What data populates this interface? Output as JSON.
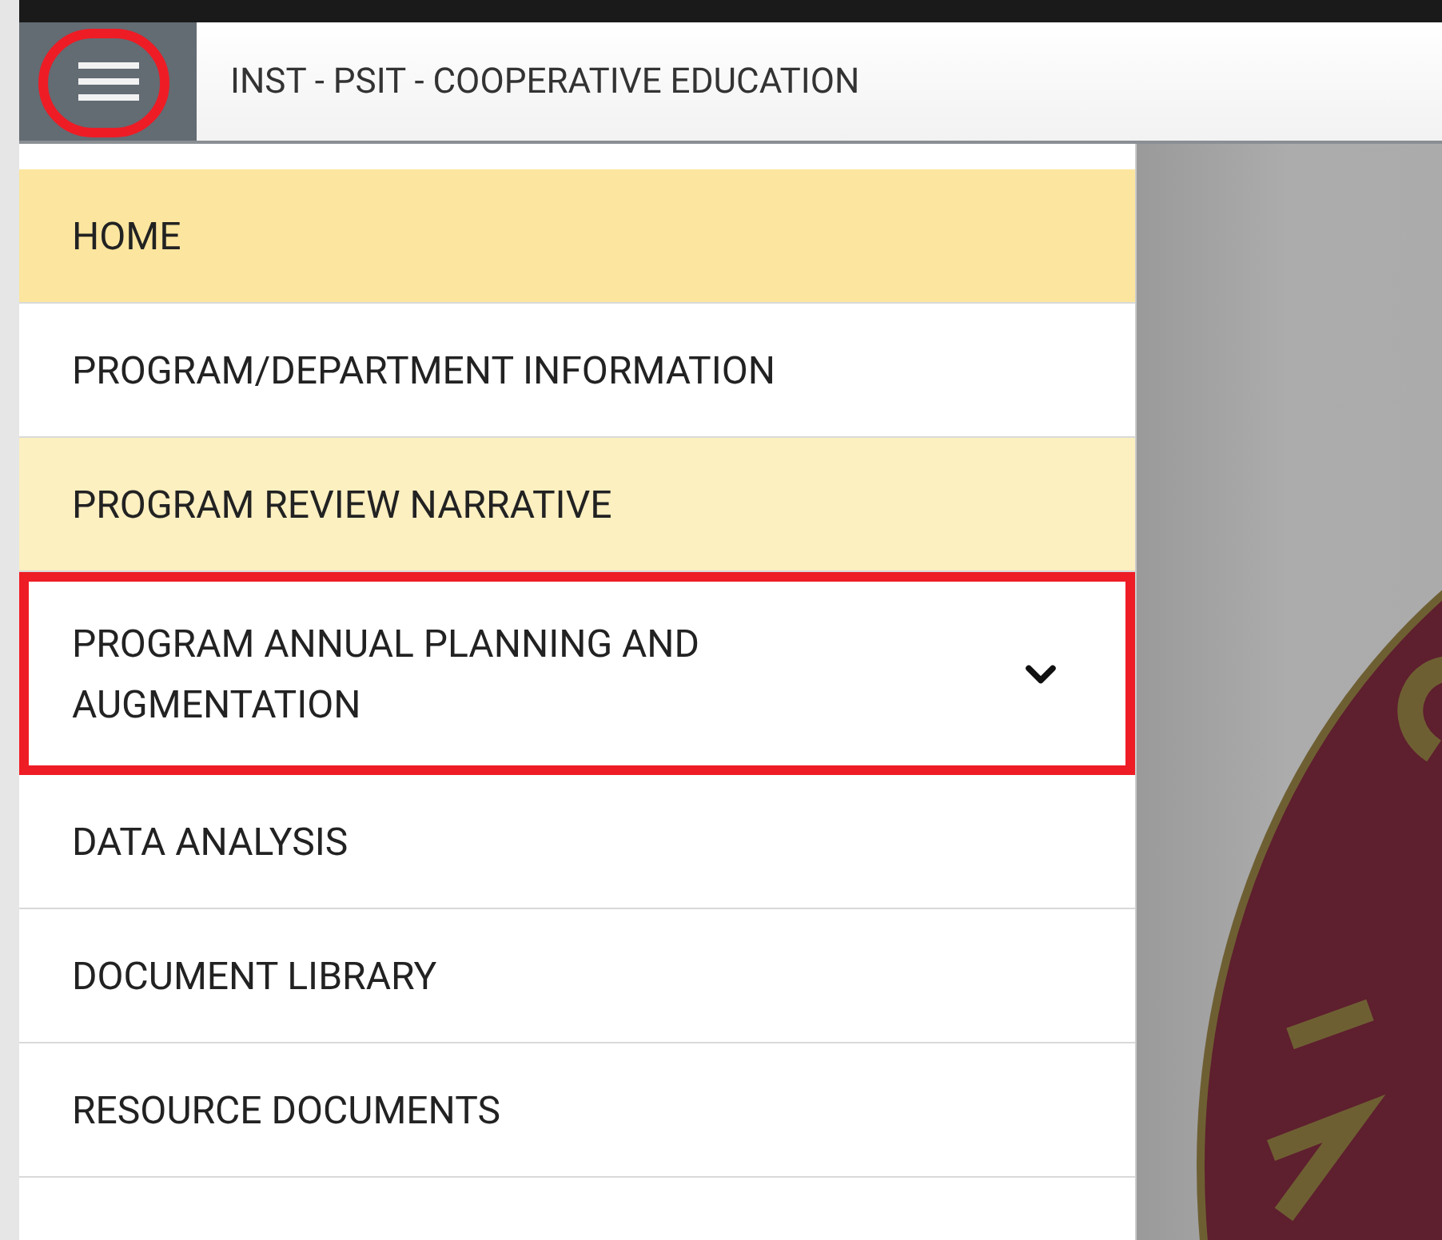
{
  "header": {
    "menu_button": {
      "annotated": true
    },
    "title": "INST - PSIT - COOPERATIVE EDUCATION"
  },
  "menu": {
    "items": [
      {
        "label": "HOME",
        "selected": true,
        "hovered": false,
        "expandable": false,
        "annotated": false
      },
      {
        "label": "PROGRAM/DEPARTMENT INFORMATION",
        "selected": false,
        "hovered": false,
        "expandable": false,
        "annotated": false
      },
      {
        "label": "PROGRAM REVIEW NARRATIVE",
        "selected": false,
        "hovered": true,
        "expandable": false,
        "annotated": false
      },
      {
        "label": "PROGRAM ANNUAL PLANNING AND AUGMENTATION",
        "selected": false,
        "hovered": false,
        "expandable": true,
        "annotated": true
      },
      {
        "label": "DATA ANALYSIS",
        "selected": false,
        "hovered": false,
        "expandable": false,
        "annotated": false
      },
      {
        "label": "DOCUMENT LIBRARY",
        "selected": false,
        "hovered": false,
        "expandable": false,
        "annotated": false
      },
      {
        "label": "RESOURCE DOCUMENTS",
        "selected": false,
        "hovered": false,
        "expandable": false,
        "annotated": false
      }
    ]
  }
}
